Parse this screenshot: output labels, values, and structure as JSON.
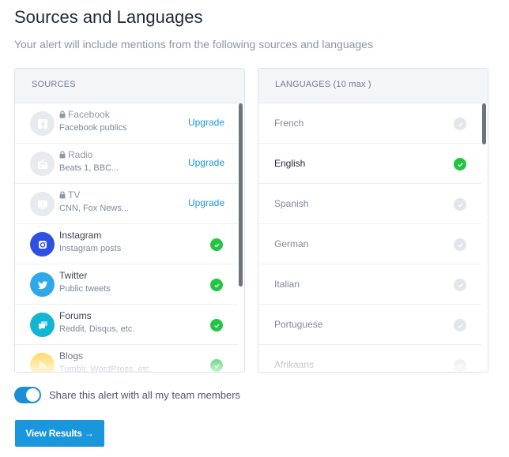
{
  "page": {
    "title": "Sources and Languages",
    "subtitle": "Your alert will include mentions from the following sources and languages"
  },
  "sources": {
    "header": "SOURCES",
    "items": [
      {
        "name": "Facebook",
        "description": "Facebook publics",
        "icon": "facebook-icon",
        "locked": true,
        "action": "Upgrade",
        "color": "#e7eaee"
      },
      {
        "name": "Radio",
        "description": "Beats 1, BBC...",
        "icon": "radio-icon",
        "locked": true,
        "action": "Upgrade",
        "color": "#e7eaee"
      },
      {
        "name": "TV",
        "description": "CNN, Fox News...",
        "icon": "tv-icon",
        "locked": true,
        "action": "Upgrade",
        "color": "#e7eaee"
      },
      {
        "name": "Instagram",
        "description": "Instagram posts",
        "icon": "instagram-icon",
        "locked": false,
        "selected": true,
        "color": "#2f4fe0"
      },
      {
        "name": "Twitter",
        "description": "Public tweets",
        "icon": "twitter-icon",
        "locked": false,
        "selected": true,
        "color": "#2ea8e8"
      },
      {
        "name": "Forums",
        "description": "Reddit, Disqus, etc.",
        "icon": "forum-icon",
        "locked": false,
        "selected": true,
        "color": "#12b5d2"
      },
      {
        "name": "Blogs",
        "description": "Tumblr, WordPress, etc.",
        "icon": "rss-icon",
        "locked": false,
        "selected": true,
        "color": "#ffd34d"
      }
    ]
  },
  "languages": {
    "header": "LANGUAGES (10 max )",
    "items": [
      {
        "name": "French",
        "selected": false
      },
      {
        "name": "English",
        "selected": true
      },
      {
        "name": "Spanish",
        "selected": false
      },
      {
        "name": "German",
        "selected": false
      },
      {
        "name": "Italian",
        "selected": false
      },
      {
        "name": "Portuguese",
        "selected": false
      },
      {
        "name": "Afrikaans",
        "selected": false
      }
    ]
  },
  "share": {
    "label": "Share this alert with all my team members",
    "enabled": true
  },
  "actions": {
    "view_results": "View Results →"
  },
  "colors": {
    "accent": "#1a97dc",
    "check_on": "#22c444",
    "check_off": "#e2e6eb",
    "link": "#1a97d8"
  }
}
